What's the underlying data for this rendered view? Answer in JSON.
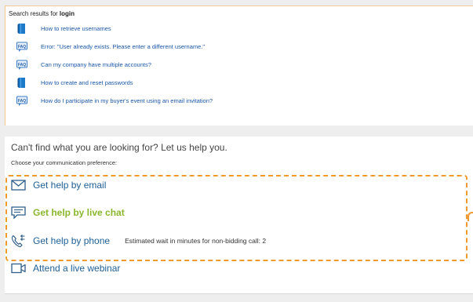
{
  "results": {
    "prefix": "Search results for ",
    "query": "login",
    "items": [
      {
        "icon": "book-icon",
        "label": "How to retrieve usernames"
      },
      {
        "icon": "faq-icon",
        "label": "Error: \"User already exists. Please enter a different username.\""
      },
      {
        "icon": "faq-icon",
        "label": "Can my company have multiple accounts?"
      },
      {
        "icon": "book-icon",
        "label": "How to create and reset passwords"
      },
      {
        "icon": "faq-icon",
        "label": "How do I participate in my buyer's event using an email invitation?"
      }
    ]
  },
  "help": {
    "title": "Can't find what you are looking for? Let us help you.",
    "subtitle": "Choose your communication preference:",
    "options": {
      "email": "Get help by email",
      "chat": "Get help by live chat",
      "phone": "Get help by phone",
      "phone_note": "Estimated wait in minutes for non-bidding call: 2",
      "webinar": "Attend a live webinar"
    }
  },
  "colors": {
    "link": "#1a57a8",
    "option": "#1f5f95",
    "chat": "#8ab82c",
    "highlight": "#ee9a2e"
  }
}
